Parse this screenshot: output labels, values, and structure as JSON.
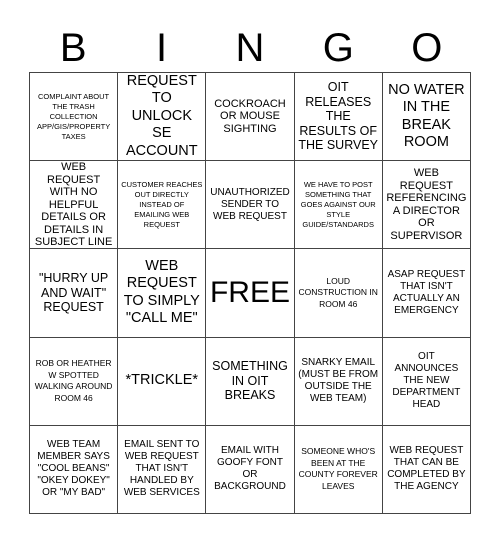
{
  "header": {
    "letters": [
      "B",
      "I",
      "N",
      "G",
      "O"
    ]
  },
  "cells": [
    [
      "COMPLAINT ABOUT THE TRASH COLLECTION APP/GIS/PROPERTY TAXES",
      "REQUEST TO UNLOCK SE ACCOUNT",
      "COCKROACH OR MOUSE SIGHTING",
      "OIT RELEASES THE RESULTS OF THE SURVEY",
      "NO WATER IN THE BREAK ROOM"
    ],
    [
      "WEB REQUEST WITH NO HELPFUL DETAILS OR DETAILS IN SUBJECT LINE",
      "CUSTOMER REACHES OUT DIRECTLY INSTEAD OF EMAILING WEB REQUEST",
      "UNAUTHORIZED SENDER TO WEB REQUEST",
      "WE HAVE TO POST SOMETHING THAT GOES AGAINST OUR STYLE GUIDE/STANDARDS",
      "WEB REQUEST REFERENCING A DIRECTOR OR SUPERVISOR"
    ],
    [
      "\"HURRY UP AND WAIT\" REQUEST",
      "WEB REQUEST TO SIMPLY \"CALL ME\"",
      "FREE",
      "LOUD CONSTRUCTION IN ROOM 46",
      "ASAP REQUEST THAT ISN'T ACTUALLY AN EMERGENCY"
    ],
    [
      "ROB OR HEATHER W SPOTTED WALKING AROUND ROOM 46",
      "*TRICKLE*",
      "SOMETHING IN OIT BREAKS",
      "SNARKY EMAIL (MUST BE FROM OUTSIDE THE WEB TEAM)",
      "OIT ANNOUNCES THE NEW DEPARTMENT HEAD"
    ],
    [
      "WEB TEAM MEMBER SAYS \"COOL BEANS\" \"OKEY DOKEY\" OR \"MY BAD\"",
      "EMAIL SENT TO WEB REQUEST THAT ISN'T HANDLED BY WEB SERVICES",
      "EMAIL WITH GOOFY FONT OR BACKGROUND",
      "SOMEONE WHO'S BEEN AT THE COUNTY FOREVER LEAVES",
      "WEB REQUEST THAT CAN BE COMPLETED BY THE AGENCY"
    ]
  ]
}
